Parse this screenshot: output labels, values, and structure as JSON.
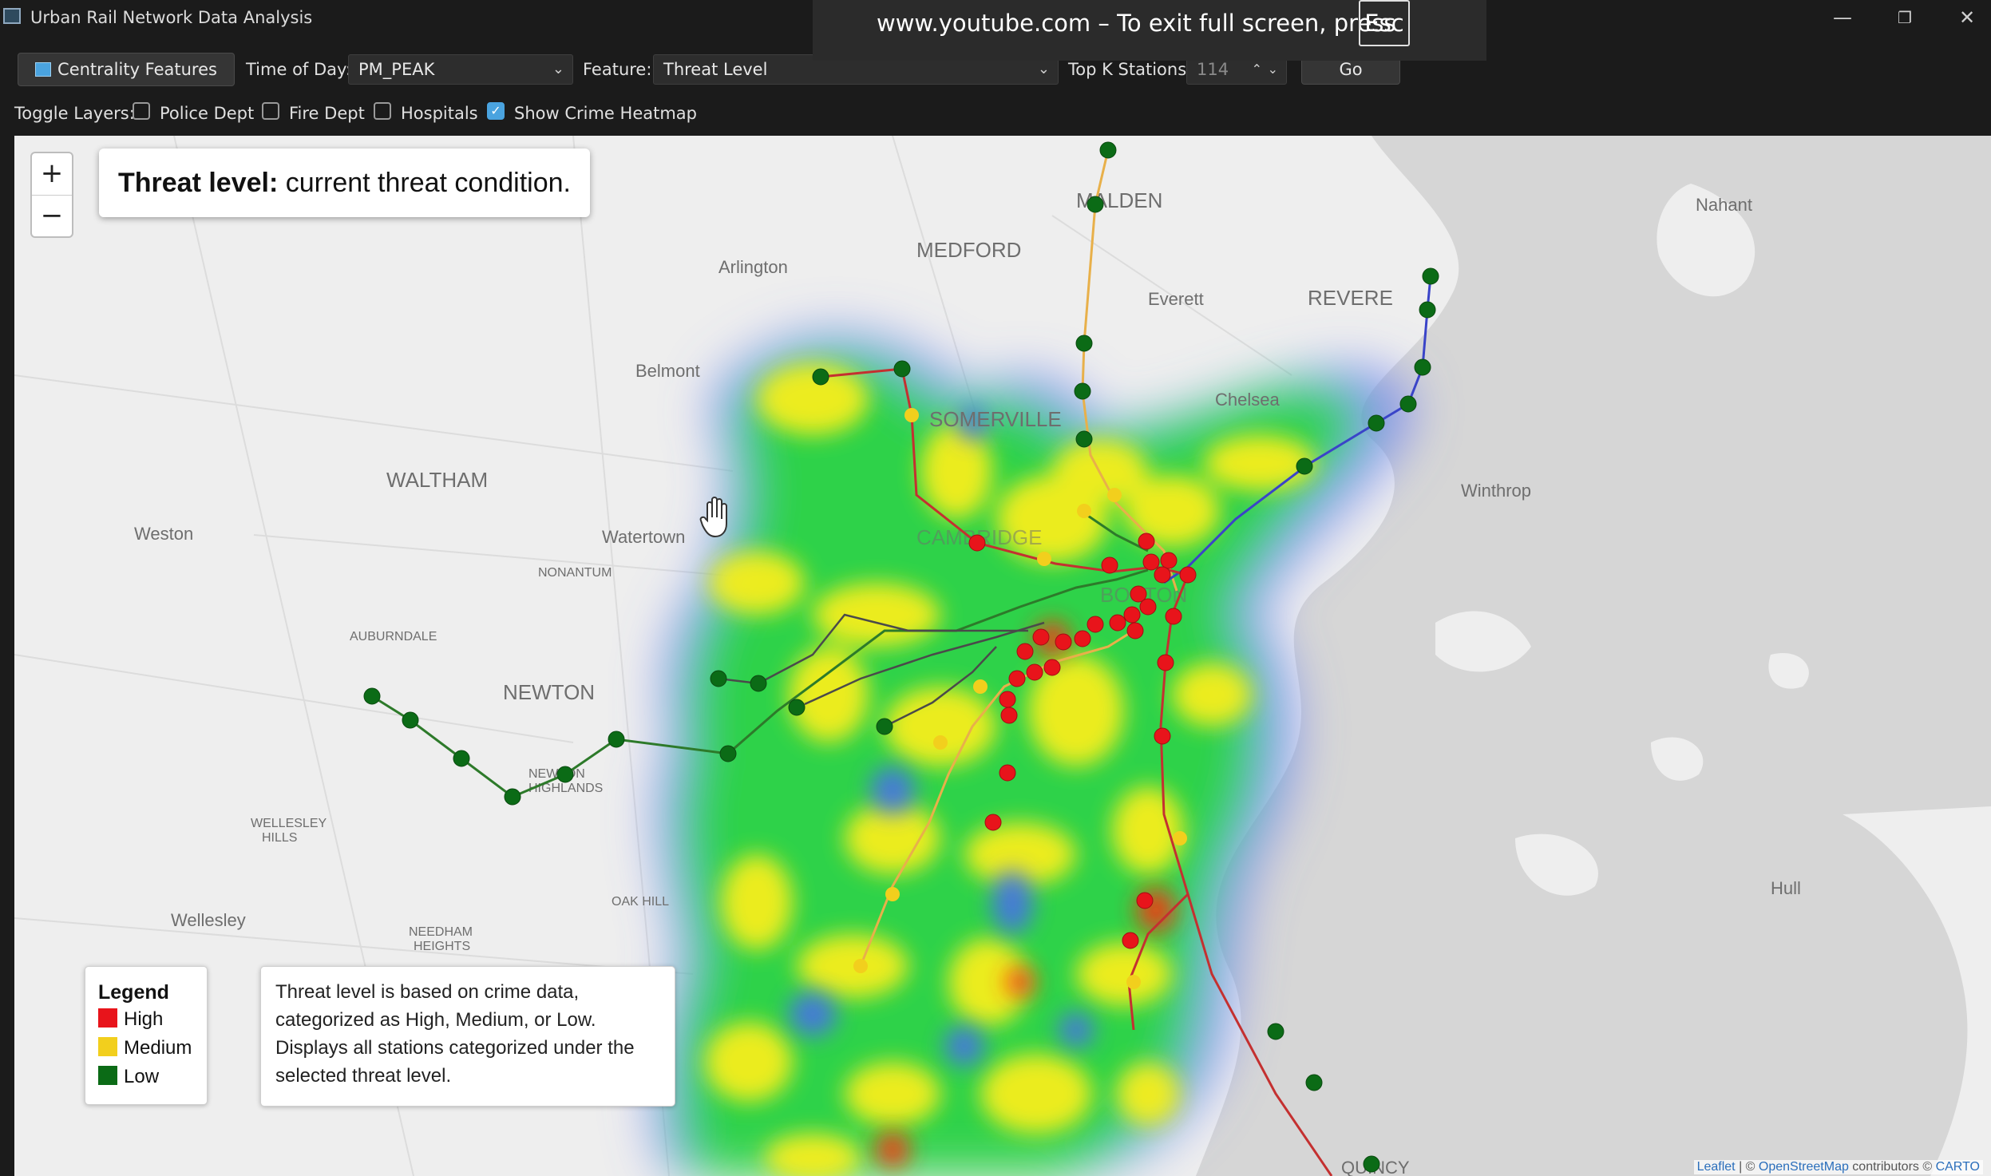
{
  "window": {
    "title": "Urban Rail Network Data Analysis",
    "controls": {
      "minimize": "—",
      "maximize": "❐",
      "close": "✕"
    }
  },
  "fullscreen_banner": {
    "text": "www.youtube.com – To exit full screen, press",
    "key": "Esc"
  },
  "toolbar": {
    "centrality_button": "Centrality Features",
    "time_of_day_label": "Time of Day:",
    "time_of_day_value": "PM_PEAK",
    "feature_label": "Feature:",
    "feature_value": "Threat Level",
    "top_k_label": "Top K Stations:",
    "top_k_value": "114",
    "go_button": "Go"
  },
  "layers": {
    "label": "Toggle Layers:",
    "items": [
      {
        "label": "Police Dept",
        "checked": false
      },
      {
        "label": "Fire Dept",
        "checked": false
      },
      {
        "label": "Hospitals",
        "checked": false
      },
      {
        "label": "Show Crime Heatmap",
        "checked": true
      }
    ]
  },
  "map": {
    "zoom_in": "+",
    "zoom_out": "−",
    "info_bold": "Threat level:",
    "info_text": " current threat condition.",
    "places": {
      "malden": "MALDEN",
      "medford": "MEDFORD",
      "arlington": "Arlington",
      "everett": "Everett",
      "revere": "REVERE",
      "nahant": "Nahant",
      "belmont": "Belmont",
      "somerville": "SOMERVILLE",
      "chelsea": "Chelsea",
      "waltham": "WALTHAM",
      "winthrop": "Winthrop",
      "weston": "Weston",
      "watertown": "Watertown",
      "nonantum": "NONANTUM",
      "cambridge": "CAMBRIDGE",
      "boston": "BOSTON",
      "auburndale": "AUBURNDALE",
      "newton": "NEWTON",
      "newton_highlands_1": "NEWTON",
      "newton_highlands_2": "HIGHLANDS",
      "wellesley_hills_1": "WELLESLEY",
      "wellesley_hills_2": "HILLS",
      "oak_hill": "OAK HILL",
      "wellesley": "Wellesley",
      "needham_heights_1": "NEEDHAM",
      "needham_heights_2": "HEIGHTS",
      "hull": "Hull",
      "quincy": "QUINCY"
    },
    "legend": {
      "title": "Legend",
      "items": [
        {
          "label": "High",
          "color": "#e8141b"
        },
        {
          "label": "Medium",
          "color": "#f2cf1d"
        },
        {
          "label": "Low",
          "color": "#0b6b16"
        }
      ]
    },
    "description": [
      "Threat level is based on crime data,",
      "categorized as High, Medium, or Low.",
      "Displays all stations categorized under the",
      "selected threat level."
    ],
    "attribution": {
      "leaflet": "Leaflet",
      "sep": " | © ",
      "osm": "OpenStreetMap",
      "contrib": " contributors © ",
      "carto": "CARTO"
    }
  }
}
